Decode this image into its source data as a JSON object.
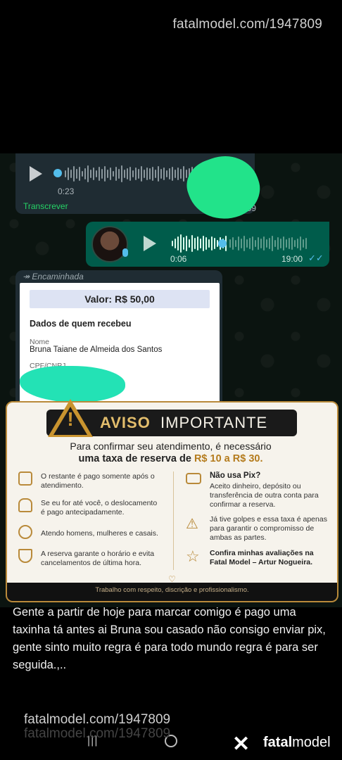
{
  "watermark": {
    "top": "fatalmodel.com/1947809",
    "bottom": "fatalmodel.com/1947809",
    "bottom_ghost": "fatalmodel.com/1947809"
  },
  "audio_in": {
    "duration": "0:23",
    "time": "19:59",
    "transcribe_label": "Transcrever"
  },
  "audio_out": {
    "duration": "0:06",
    "time": "19:00",
    "read_icon": "double-check-icon"
  },
  "forwarded": {
    "label": "Encaminhada",
    "valor": "Valor: R$ 50,00",
    "section_title": "Dados de quem recebeu",
    "name_label": "Nome",
    "name_value": "Bruna Taiane de Almeida dos Santos",
    "cpf_label": "CPF/CNPJ"
  },
  "aviso": {
    "banner_left": "AVISO",
    "banner_right": "IMPORTANTE",
    "line1": "Para confirmar seu atendimento, é necessário",
    "line2_prefix": "uma taxa de reserva de ",
    "line2_amount": "R$ 10 a R$ 30.",
    "left_items": [
      {
        "icon": "calendar-money-icon",
        "text": "O restante é pago somente após o atendimento."
      },
      {
        "icon": "car-icon",
        "text": "Se eu for até você, o deslocamento é pago antecipadamente."
      },
      {
        "icon": "people-icon",
        "text": "Atendo homens, mulheres e casais."
      },
      {
        "icon": "shield-check-icon",
        "text": "A reserva garante o horário e evita cancelamentos de última hora."
      }
    ],
    "right_items": [
      {
        "icon": "cash-icon",
        "title": "Não usa Pix?",
        "text": "Aceito dinheiro, depósito ou transferência de outra conta para confirmar a reserva."
      },
      {
        "icon": "warning-icon",
        "title": "",
        "text": "Já tive golpes e essa taxa é apenas para garantir o compromisso de ambas as partes."
      },
      {
        "icon": "star-icon",
        "title": "Confira minhas avaliações na Fatal Model – Artur Nogueira.",
        "text": ""
      }
    ],
    "footer": "Trabalho com respeito, discrição e profissionalismo."
  },
  "caption": "Gente a partir de hoje para marcar comigo é pago uma taxinha tá antes ai Bruna sou casado não consigo enviar pix, gente sinto muito regra é para todo mundo regra é para ser seguida.,..",
  "brand": {
    "name_prefix": "fatal",
    "name_suffix": "model"
  },
  "colors": {
    "accent_green": "#25d366",
    "gold": "#b98a3a",
    "bubble_out": "#005c4b"
  }
}
